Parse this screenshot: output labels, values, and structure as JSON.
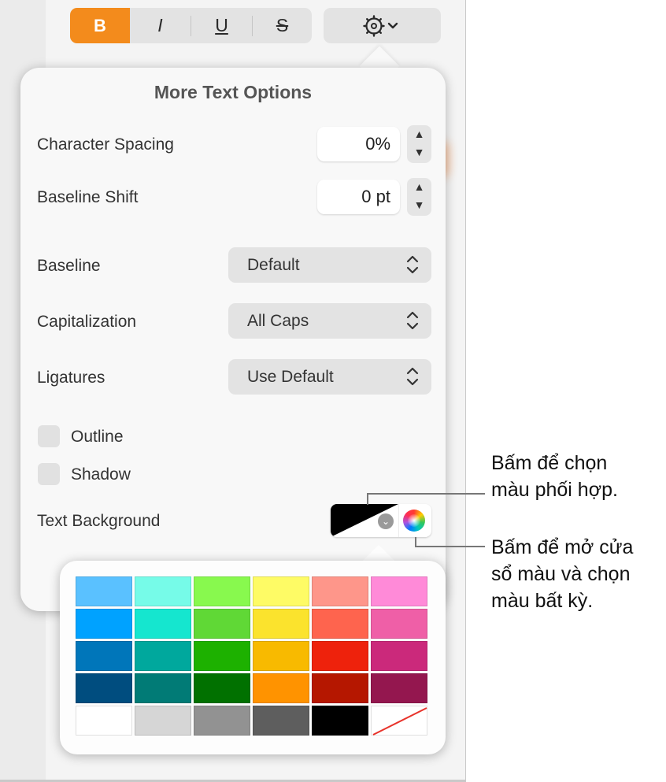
{
  "toolbar": {
    "bold_label": "B",
    "italic_label": "I",
    "underline_label": "U",
    "strike_label": "S",
    "gear_icon": "gear-icon",
    "chevron_icon": "chevron-down-icon",
    "accent_color": "#f38b1c"
  },
  "popover": {
    "title": "More Text Options",
    "character_spacing": {
      "label": "Character Spacing",
      "value": "0%"
    },
    "baseline_shift": {
      "label": "Baseline Shift",
      "value": "0 pt"
    },
    "baseline": {
      "label": "Baseline",
      "value": "Default"
    },
    "capitalization": {
      "label": "Capitalization",
      "value": "All Caps"
    },
    "ligatures": {
      "label": "Ligatures",
      "value": "Use Default"
    },
    "outline": {
      "label": "Outline",
      "checked": false
    },
    "shadow": {
      "label": "Shadow",
      "checked": false
    },
    "text_background": {
      "label": "Text Background",
      "well_color": "#000000"
    }
  },
  "palette": {
    "rows": [
      [
        "#5ac1ff",
        "#76fbe8",
        "#88f94e",
        "#fefb65",
        "#fe968a",
        "#ff8ad8"
      ],
      [
        "#00a2ff",
        "#15e6cf",
        "#60d836",
        "#fbe32d",
        "#fe644e",
        "#ef5fa7"
      ],
      [
        "#0076ba",
        "#00a89d",
        "#1db100",
        "#f8ba00",
        "#ee220c",
        "#cb297b"
      ],
      [
        "#004d7f",
        "#017b76",
        "#017100",
        "#ff9300",
        "#b51700",
        "#94174f"
      ],
      [
        "#ffffff",
        "#d6d6d6",
        "#929292",
        "#5e5e5e",
        "#000000",
        "none"
      ]
    ]
  },
  "callouts": {
    "first_line1": "Bấm để chọn",
    "first_line2": "màu phối hợp.",
    "second_line1": "Bấm để mở cửa",
    "second_line2": "sổ màu và chọn",
    "second_line3": "màu bất kỳ."
  }
}
